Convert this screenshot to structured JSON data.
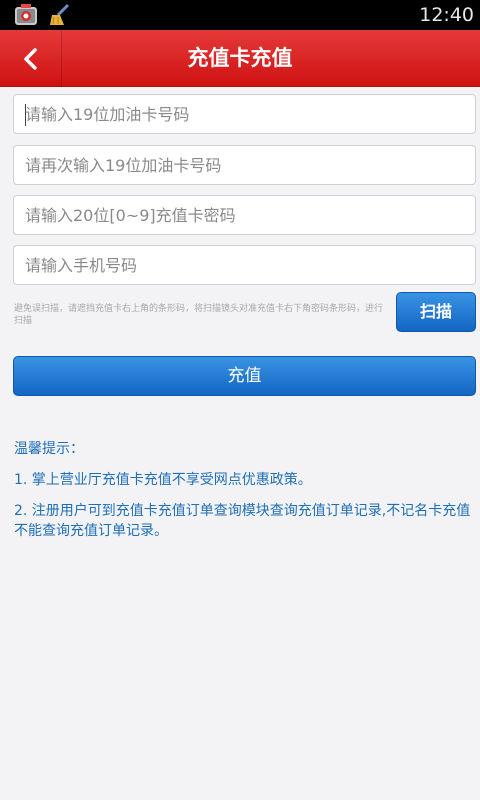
{
  "status_bar": {
    "time": "12:40"
  },
  "header": {
    "title": "充值卡充值"
  },
  "form": {
    "card_number_placeholder": "请输入19位加油卡号码",
    "card_number_confirm_placeholder": "请再次输入19位加油卡号码",
    "card_password_placeholder": "请输入20位[0~9]充值卡密码",
    "phone_placeholder": "请输入手机号码",
    "scan_hint": "避免误扫描，请遮挡充值卡右上角的条形码，将扫描镜头对准充值卡右下角密码条形码，进行扫描",
    "scan_label": "扫描",
    "submit_label": "充值"
  },
  "tips": {
    "title": "温馨提示：",
    "items": [
      "1. 掌上营业厅充值卡充值不享受网点优惠政策。",
      "2. 注册用户可到充值卡充值订单查询模块查询充值订单记录,不记名卡充值不能查询充值订单记录。"
    ]
  },
  "colors": {
    "header": "#d81e1e",
    "button": "#1a73d0",
    "tips_text": "#1f6fb8"
  }
}
